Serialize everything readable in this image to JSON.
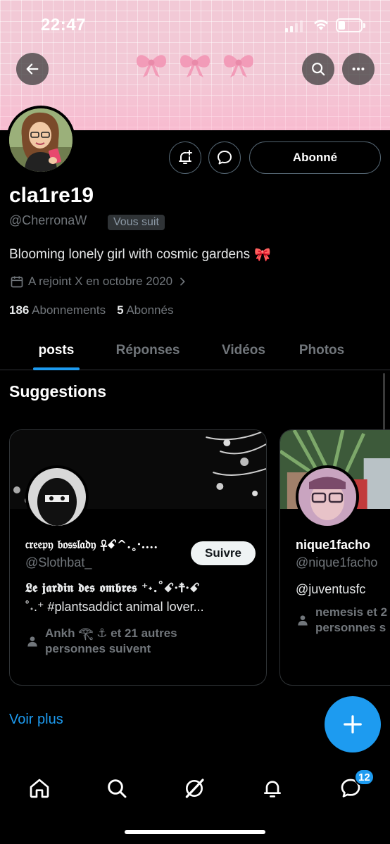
{
  "status_bar": {
    "time": "22:47"
  },
  "profile": {
    "display_name": "cla1re19",
    "handle": "@CherronaW",
    "follows_you": "Vous suit",
    "bio": "Blooming lonely girl with cosmic gardens",
    "bio_emoji": "🎀",
    "joined": "A rejoint X en octobre 2020",
    "following_count": "186",
    "following_label": "Abonnements",
    "followers_count": "5",
    "followers_label": "Abonnés",
    "follow_state_label": "Abonné"
  },
  "tabs": [
    {
      "label": "posts",
      "active": true
    },
    {
      "label": "Réponses",
      "active": false
    },
    {
      "label": "Vidéos",
      "active": false
    },
    {
      "label": "Photos",
      "active": false
    }
  ],
  "suggestions": {
    "title": "Suggestions",
    "cards": [
      {
        "name": "𝔠𝔯𝔢𝔢𝔭𝔶 𝔟𝔬𝔰𝔰𝔩𝔞𝔡𝔶 ☥ꗃ^.˳·....",
        "handle": "@Slothbat_",
        "follow_label": "Suivre",
        "bio_line1": "𝕷𝖊 𝖏𝖆𝖗𝖉𝖎𝖓 𝖉𝖊𝖘 𝖔𝖒𝖇𝖗𝖊𝖘 ⁺˖.˚ꗃ·☨·ꗃ",
        "bio_line2": "˚˖.⁺ #plantsaddict animal lover...",
        "social_line1": "Ankh 𓂀 ⚓ et 21 autres",
        "social_line2": "personnes suivent"
      },
      {
        "name": "nique1facho",
        "handle": "@nique1facho",
        "bio_line1": "@juventusfc",
        "social_line1": "nemesis et 2",
        "social_line2": "personnes s"
      }
    ],
    "more_label": "Voir plus"
  },
  "bottom_nav": {
    "messages_badge": "12"
  },
  "colors": {
    "accent": "#1d9bf0",
    "banner": "#f2c9d6",
    "bows": "#f29bb8"
  },
  "icons": [
    "back-arrow-icon",
    "search-icon",
    "more-icon",
    "notification-bell-plus-icon",
    "message-icon",
    "calendar-icon",
    "chevron-right-icon",
    "person-icon",
    "plus-icon",
    "home-icon",
    "grok-icon",
    "bell-icon",
    "messages-icon"
  ]
}
